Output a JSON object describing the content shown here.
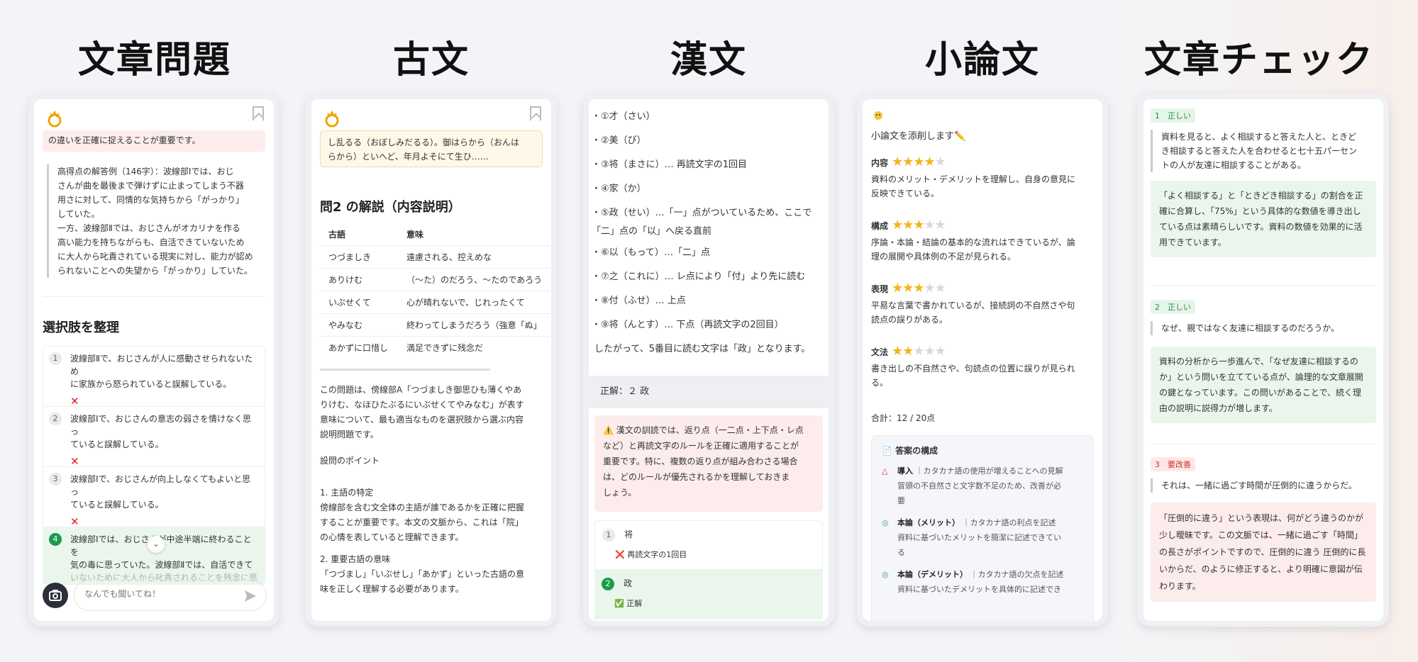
{
  "titles": [
    "文章問題",
    "古文",
    "漢文",
    "小論文",
    "文章チェック"
  ],
  "p1": {
    "top_text": "の違いを正確に捉えることが重要です。",
    "answer_example": [
      "高得点の解答例（146字）：波線部Ⅰでは、おじ",
      "さんが曲を最後まで弾けずに止まってしまう不器",
      "用さに対して、同情的な気持ちから「がっかり」",
      "していた。",
      "一方、波線部Ⅱでは、おじさんがオカリナを作る",
      "高い能力を持ちながらも、自活できていないため",
      "に大人から叱責されている現実に対し、能力が認め",
      "られないことへの失望から「がっかり」していた。"
    ],
    "section": "選択肢を整理",
    "options": [
      {
        "num": "1",
        "lines": [
          "波線部Ⅱで、おじさんが人に感動させられないため",
          "に家族から怒られていると誤解している。"
        ],
        "mark": "✕"
      },
      {
        "num": "2",
        "lines": [
          "波線部Ⅰで、おじさんの意志の弱さを情けなく思っ",
          "ていると誤解している。"
        ],
        "mark": "✕"
      },
      {
        "num": "3",
        "lines": [
          "波線部Ⅰで、おじさんが向上しなくてもよいと思っ",
          "ていると誤解している。"
        ],
        "mark": "✕"
      },
      {
        "num": "4",
        "lines": [
          "波線部Ⅰでは、おじさんが中途半端に終わることを",
          "気の毒に思っていた。波線部Ⅱでは、自活できて",
          "いないために大人から叱責されることを残念に思っ"
        ]
      }
    ],
    "input_placeholder": "なんでも聞いてね！"
  },
  "p2": {
    "top_text": [
      "し乱るる（おぼしみだるる）。御はらから（おんは",
      "らから）といへど、年月よそにて生ひ……"
    ],
    "heading": "問2 の解説（内容説明）",
    "table_head": [
      "古語",
      "意味"
    ],
    "table_rows": [
      [
        "つづましき",
        "遠慮される、控えめな"
      ],
      [
        "ありけむ",
        "（〜た）のだろう、〜たのであろう"
      ],
      [
        "いぶせくて",
        "心が晴れないで、じれったくて"
      ],
      [
        "やみなむ",
        "終わってしまうだろう（強意「ぬ」"
      ],
      [
        "あかずに口惜し",
        "満足できずに残念だ"
      ]
    ],
    "body": [
      "この問題は、傍線部A「つづましき御思ひも薄くやあ",
      "りけむ、なほひたぶるにいぶせくてやみなむ」が表す",
      "意味について、最も適当なものを選択肢から選ぶ内容",
      "説明問題です。"
    ],
    "point_title": "設問のポイント",
    "p1_title": "1. 主語の特定",
    "p1_body": [
      "傍線部を含む文全体の主語が誰であるかを正確に把握",
      "することが重要です。本文の文脈から、これは「院」",
      "の心情を表していると理解できます。"
    ],
    "p2_title": "2. 重要古語の意味",
    "p2_body": [
      "「つづまし」「いぶせし」「あかず」といった古語の意",
      "味を正しく理解する必要があります。"
    ]
  },
  "p3": {
    "list": [
      "・①才（さい）",
      "・②美（び）",
      "・③将（まさに）… 再読文字の1回目",
      "・④家（か）",
      "・⑤政（せい）…「一」点がついているため、ここで",
      "「二」点の「以」へ戻る直前",
      "・⑥以（もって）…「二」点",
      "・⑦之（これに）… レ点により「付」より先に読む",
      "・⑧付（ふせ）… 上点",
      "・⑨将（んとす）… 下点（再読文字の2回目）"
    ],
    "conclusion": "したがって、5番目に読む文字は「政」となります。",
    "answer": "正解：２ 政",
    "warning": [
      "⚠️ 漢文の訓読では、返り点（一二点・上下点・レ点",
      "など）と再読文字のルールを正確に適用することが",
      "重要です。特に、複数の返り点が組み合わさる場合",
      "は、どのルールが優先されるかを理解しておきま",
      "しょう。"
    ],
    "choices": [
      {
        "num": "1",
        "label": "将",
        "result": "❌ 再読文字の1回目"
      },
      {
        "num": "2",
        "label": "政",
        "result": "✅ 正解"
      }
    ]
  },
  "p4": {
    "intro": "小論文を添削します✏️",
    "criteria": [
      {
        "name": "内容",
        "stars": 4,
        "desc": [
          "資料のメリット・デメリットを理解し、自身の意見に",
          "反映できている。"
        ]
      },
      {
        "name": "構成",
        "stars": 3,
        "desc": [
          "序論・本論・結論の基本的な流れはできているが、論",
          "理の展開や具体例の不足が見られる。"
        ]
      },
      {
        "name": "表現",
        "stars": 3,
        "desc": [
          "平易な言葉で書かれているが、接続詞の不自然さや句",
          "読点の誤りがある。"
        ]
      },
      {
        "name": "文法",
        "stars": 2,
        "desc": [
          "書き出しの不自然さや、句読点の位置に誤りが見られ",
          "る。"
        ]
      }
    ],
    "total": "合計：12 / 20点",
    "structure_title": "📄 答案の構成",
    "structure": [
      {
        "icon": "△",
        "head": "導入",
        "text": [
          "｜カタカナ語の使用が増えることへの見解",
          "冒頭の不自然さと文字数不足のため、改善が必",
          "要"
        ]
      },
      {
        "icon": "◎",
        "head": "本論（メリット）",
        "text": [
          "｜カタカナ語の利点を記述",
          "資料に基づいたメリットを簡潔に記述できてい",
          "る"
        ]
      },
      {
        "icon": "◎",
        "head": "本論（デメリット）",
        "text": [
          "｜カタカナ語の欠点を記述",
          "資料に基づいたデメリットを具体的に記述でき"
        ]
      }
    ]
  },
  "p5": {
    "items": [
      {
        "num": "1",
        "status": "正しい",
        "kind": "ok",
        "quote": [
          "資料を見ると、よく相談すると答えた人と、ときど",
          "き相談すると答えた人を合わせると七十五パーセン",
          "トの人が友達に相談することがある。"
        ],
        "comment": [
          "「よく相談する」と「ときどき相談する」の割合を正",
          "確に合算し、「75%」という具体的な数値を導き出し",
          "ている点は素晴らしいです。資料の数値を効果的に活",
          "用できています。"
        ]
      },
      {
        "num": "2",
        "status": "正しい",
        "kind": "ok",
        "quote": [
          "なぜ、親ではなく友達に相談するのだろうか。"
        ],
        "comment": [
          "資料の分析から一歩進んで、「なぜ友達に相談するの",
          "か」という問いを立てている点が、論理的な文章展開",
          "の鍵となっています。この問いがあることで、続く理",
          "由の説明に説得力が増します。"
        ]
      },
      {
        "num": "3",
        "status": "要改善",
        "kind": "ng",
        "quote": [
          "それは、一緒に過ごす時間が圧倒的に違うからだ。"
        ],
        "comment": [
          "「圧倒的に違う」という表現は、何がどう違うのかが",
          "少し曖昧です。この文脈では、一緒に過ごす「時間」",
          "の長さがポイントですので、圧倒的に違う 圧倒的に長",
          "いからだ、のように修正すると、より明確に意図が伝",
          "わります。"
        ]
      }
    ]
  }
}
